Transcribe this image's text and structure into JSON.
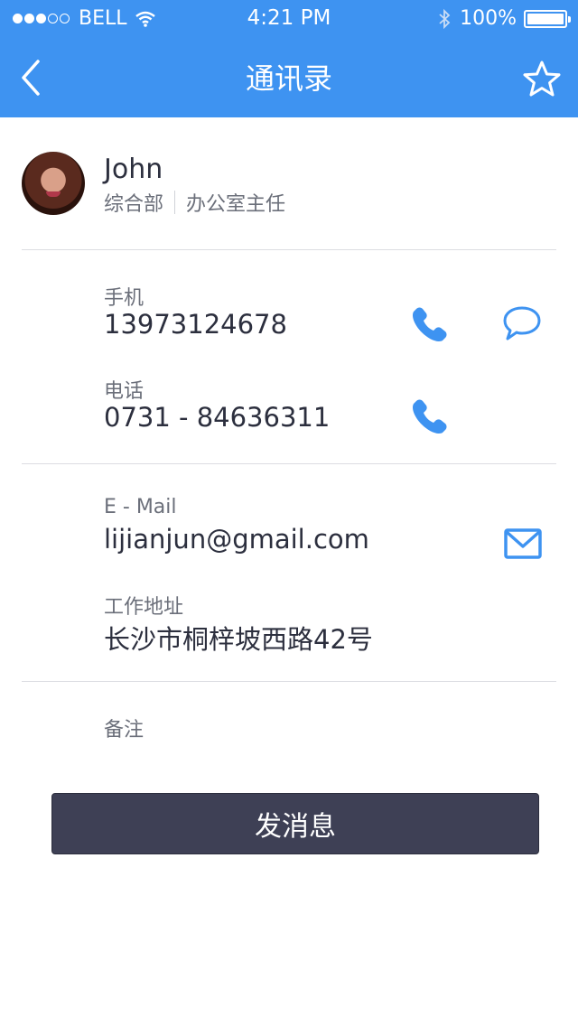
{
  "status_bar": {
    "carrier": "BELL",
    "time": "4:21 PM",
    "battery": "100%"
  },
  "nav": {
    "title": "通讯录"
  },
  "contact": {
    "name": "John",
    "department": "综合部",
    "position": "办公室主任"
  },
  "fields": {
    "mobile_label": "手机",
    "mobile_value": "13973124678",
    "phone_label": "电话",
    "phone_value": "0731 - 84636311",
    "email_label": "E - Mail",
    "email_value": "lijianjun@gmail.com",
    "address_label": "工作地址",
    "address_value": "长沙市桐梓坡西路42号",
    "notes_label": "备注"
  },
  "actions": {
    "send_message": "发消息"
  },
  "colors": {
    "header_blue": "#3e93f1",
    "icon_blue": "#3e93f1",
    "button_dark": "#3e4055"
  },
  "icons": [
    "back-chevron",
    "star",
    "phone",
    "chat-bubble",
    "mail",
    "wifi",
    "bluetooth",
    "battery"
  ]
}
